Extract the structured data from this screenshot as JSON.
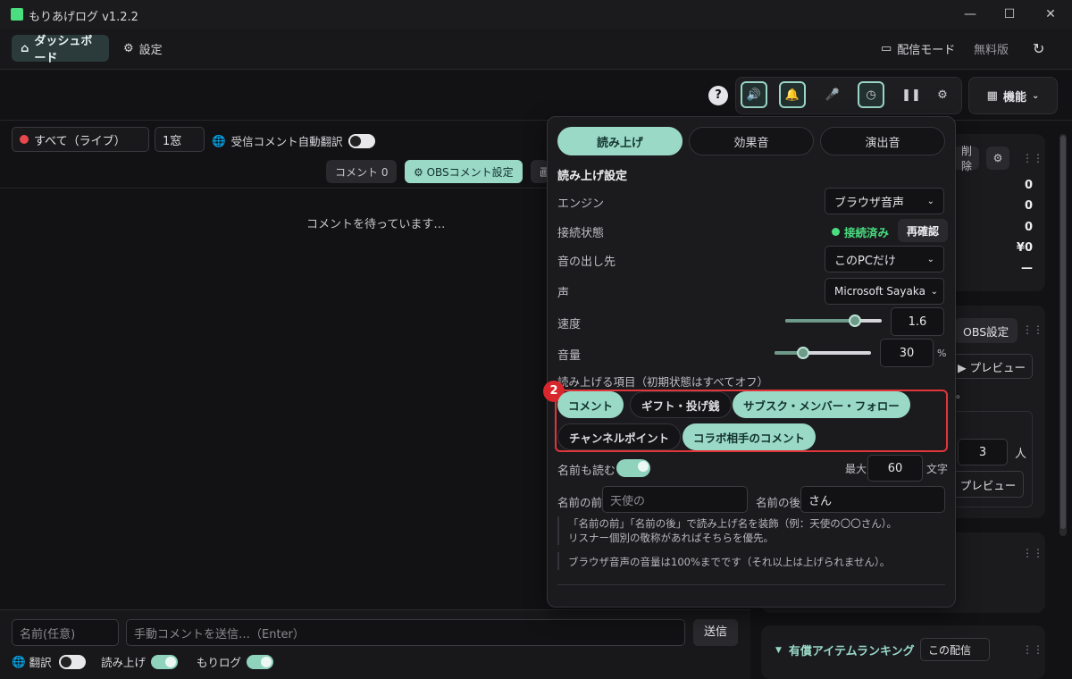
{
  "app": {
    "title": "もりあげログ  v1.2.2"
  },
  "nav": {
    "dashboard": "ダッシュボード",
    "settings": "設定",
    "stream_mode": "配信モード",
    "free": "無料版"
  },
  "toolbar": {
    "help": "?",
    "features": "機能"
  },
  "left": {
    "source_select": "すべて（ライブ）",
    "window_select": "1窓",
    "auto_translate": "受信コメント自動翻訳",
    "comment_count": "コメント 0",
    "obs_comment_settings": "⚙ OBSコメント設定",
    "partial": "画",
    "waiting": "コメントを待っています…",
    "name_placeholder": "名前(任意)",
    "manual_placeholder": "手動コメントを送信…（Enter）",
    "send": "送信",
    "translate": "翻訳",
    "tts": "読み上げ",
    "morilog": "もりログ"
  },
  "right": {
    "delete_partial": "削除",
    "stats": [
      "0",
      "0",
      "0",
      "¥0",
      "—"
    ],
    "obs_settings_partial": "OBS設定",
    "preview": "▶ プレビュー",
    "preview2": "プレビュー",
    "people_value": "3",
    "people_unit": "人",
    "period_partial": "。",
    "ranking_title": "有償アイテムランキング",
    "ranking_scope": "この配信"
  },
  "panel": {
    "tabs": [
      "読み上げ",
      "効果音",
      "演出音"
    ],
    "section_title": "読み上げ設定",
    "engine_label": "エンジン",
    "engine_value": "ブラウザ音声",
    "connection_label": "接続状態",
    "connection_status": "接続済み",
    "recheck": "再確認",
    "output_label": "音の出し先",
    "output_value": "このPCだけ",
    "voice_label": "声",
    "voice_value": "Microsoft Sayaka",
    "speed_label": "速度",
    "speed_value": "1.6",
    "volume_label": "音量",
    "volume_value": "30",
    "volume_unit": "%",
    "items_label": "読み上げる項目（初期状態はすべてオフ）",
    "badge": "2",
    "chips": [
      {
        "label": "コメント",
        "on": true
      },
      {
        "label": "ギフト・投げ銭",
        "on": false
      },
      {
        "label": "サブスク・メンバー・フォロー",
        "on": true
      },
      {
        "label": "チャンネルポイント",
        "on": false
      },
      {
        "label": "コラボ相手のコメント",
        "on": true
      }
    ],
    "read_names_label": "名前も読む",
    "max_label": "最大",
    "max_value": "60",
    "max_unit": "文字",
    "before_label": "名前の前",
    "before_placeholder": "天使の",
    "after_label": "名前の後",
    "after_value": "さん",
    "note1": "「名前の前」「名前の後」で読み上げ名を装飾（例：天使の〇〇さん）。",
    "note2": "リスナー個別の敬称があればそちらを優先。",
    "note3": "ブラウザ音声の音量は100%までです（それ以上は上げられません）。"
  },
  "chart_data": null,
  "colors": {
    "accent": "#9ad9c6",
    "highlight": "#e0353a",
    "connected": "#4ade80"
  },
  "slider_levels": {
    "speed_fraction": 0.72,
    "volume_fraction": 0.3
  }
}
